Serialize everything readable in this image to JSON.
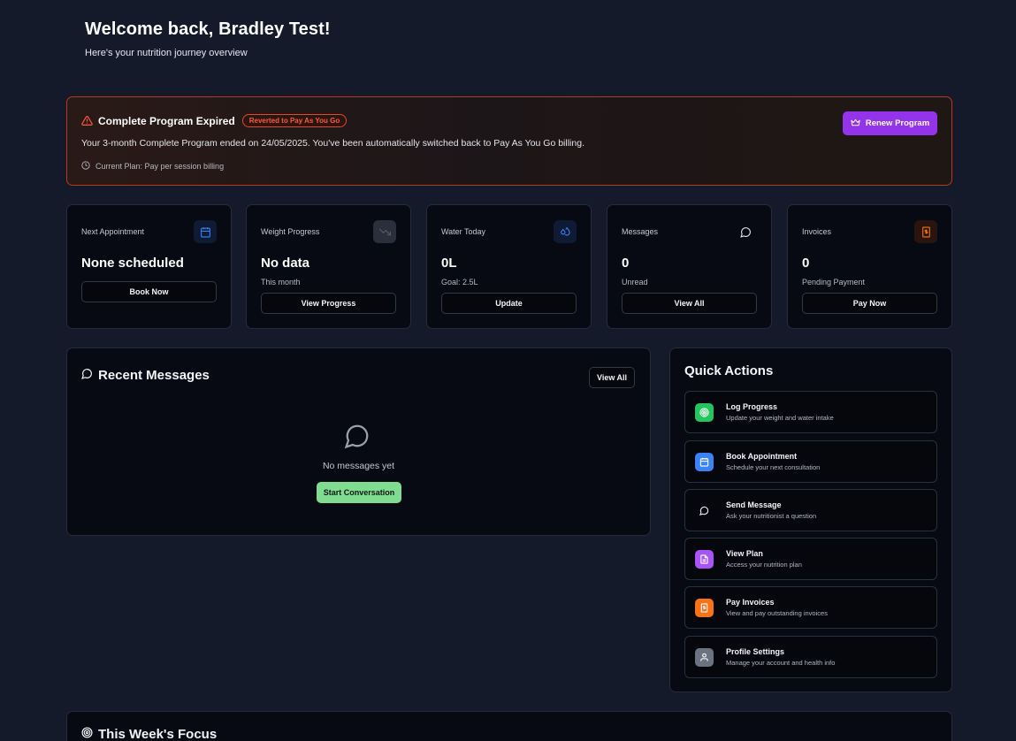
{
  "header": {
    "title": "Welcome back, Bradley Test!",
    "subtitle": "Here's your nutrition journey overview"
  },
  "banner": {
    "title": "Complete Program Expired",
    "badge": "Reverted to Pay As You Go",
    "description": "Your 3-month Complete Program ended on 24/05/2025. You've been automatically switched back to Pay As You Go billing.",
    "plan": "Current Plan: Pay per session billing",
    "renew_label": "Renew Program",
    "accent_color": "#b43b1f"
  },
  "cards": [
    {
      "label": "Next Appointment",
      "value": "None scheduled",
      "sub": "",
      "button": "Book Now",
      "icon": "calendar-icon"
    },
    {
      "label": "Weight Progress",
      "value": "No data",
      "sub": "This month",
      "button": "View Progress",
      "icon": "trending-down-icon"
    },
    {
      "label": "Water Today",
      "value": "0L",
      "sub": "Goal: 2.5L",
      "button": "Update",
      "icon": "droplets-icon"
    },
    {
      "label": "Messages",
      "value": "0",
      "sub": "Unread",
      "button": "View All",
      "icon": "message-circle-icon"
    },
    {
      "label": "Invoices",
      "value": "0",
      "sub": "Pending Payment",
      "button": "Pay Now",
      "icon": "receipt-icon"
    }
  ],
  "recent_messages": {
    "title": "Recent Messages",
    "view_all": "View All",
    "empty_text": "No messages yet",
    "start_label": "Start Conversation"
  },
  "quick_actions": {
    "title": "Quick Actions",
    "items": [
      {
        "title": "Log Progress",
        "sub": "Update your weight and water intake",
        "color": "#22c55e",
        "icon": "target-icon"
      },
      {
        "title": "Book Appointment",
        "sub": "Schedule your next consultation",
        "color": "#3b82f6",
        "icon": "calendar-icon"
      },
      {
        "title": "Send Message",
        "sub": "Ask your nutritionist a question",
        "color": "#070a13",
        "icon": "message-circle-icon"
      },
      {
        "title": "View Plan",
        "sub": "Access your nutrition plan",
        "color": "#a855f7",
        "icon": "file-icon"
      },
      {
        "title": "Pay Invoices",
        "sub": "View and pay outstanding invoices",
        "color": "#f97316",
        "icon": "receipt-icon"
      },
      {
        "title": "Profile Settings",
        "sub": "Manage your account and health info",
        "color": "#6b7280",
        "icon": "user-icon"
      }
    ]
  },
  "focus": {
    "title": "This Week's Focus"
  }
}
